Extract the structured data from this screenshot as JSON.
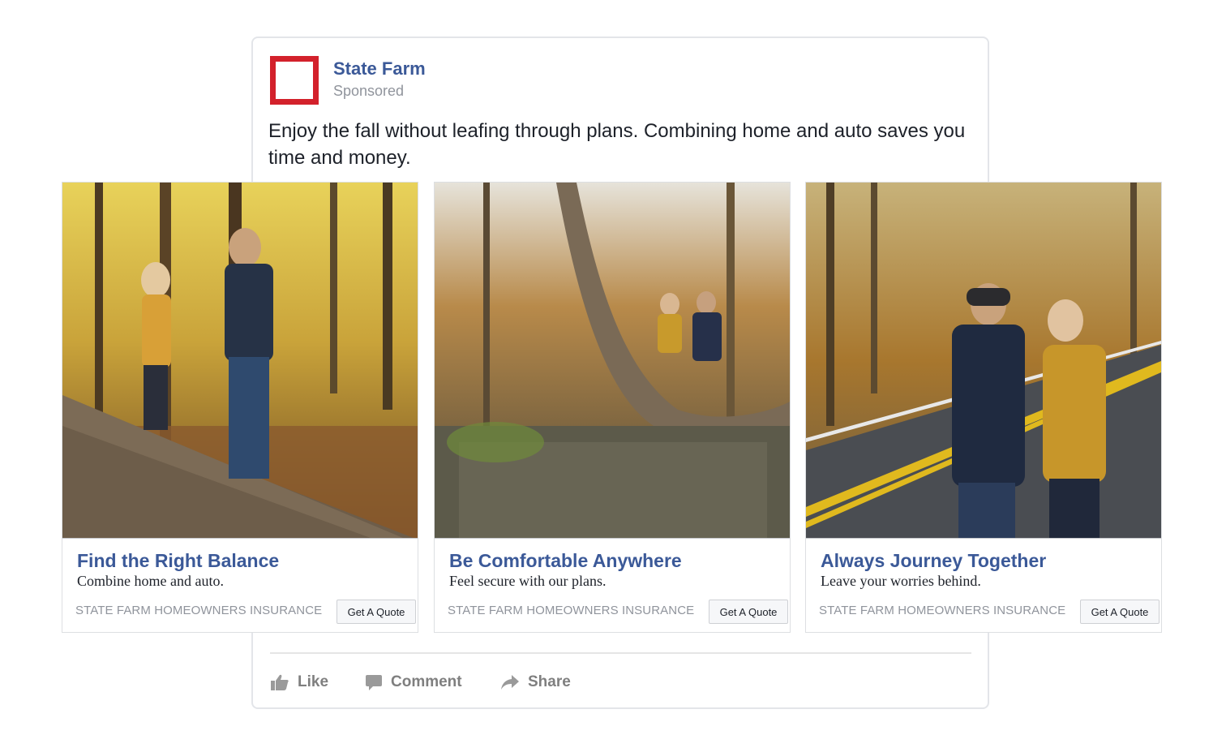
{
  "post": {
    "page_name": "State Farm",
    "sponsored_label": "Sponsored",
    "text": "Enjoy the fall without leafing through plans. Combining home and auto saves you time and money.",
    "logo_color": "#d3212b",
    "brand_link_color": "#3b5998"
  },
  "cards": [
    {
      "title": "Find the Right Balance",
      "description": "Combine home and auto.",
      "caption": "STATE FARM HOMEOWNERS INSURANCE",
      "cta": "Get A Quote"
    },
    {
      "title": "Be Comfortable Anywhere",
      "description": "Feel secure with our plans.",
      "caption": "STATE FARM HOMEOWNERS INSURANCE",
      "cta": "Get A Quote"
    },
    {
      "title": "Always Journey Together",
      "description": "Leave your worries behind.",
      "caption": "STATE FARM HOMEOWNERS INSURANCE",
      "cta": "Get A Quote"
    }
  ],
  "actions": {
    "like": "Like",
    "comment": "Comment",
    "share": "Share",
    "icons": [
      "thumbs-up-icon",
      "comment-icon",
      "share-arrow-icon"
    ]
  }
}
